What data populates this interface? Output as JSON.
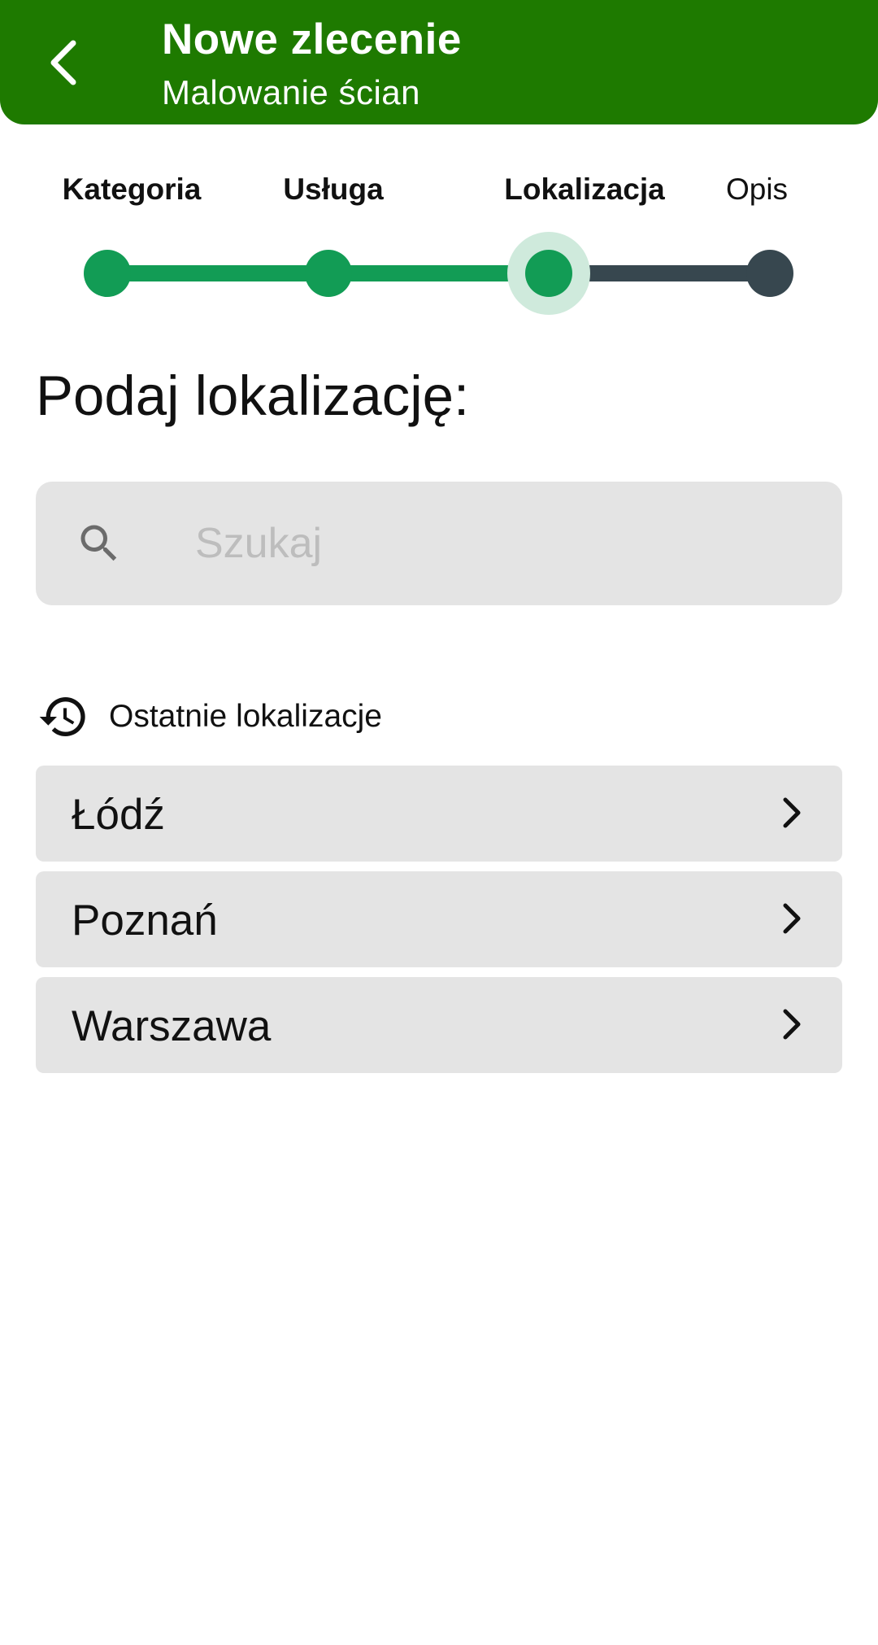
{
  "header": {
    "title": "Nowe zlecenie",
    "subtitle": "Malowanie ścian",
    "back_icon": "chevron-left-icon"
  },
  "stepper": {
    "steps": [
      {
        "label": "Kategoria",
        "state": "done"
      },
      {
        "label": "Usługa",
        "state": "done"
      },
      {
        "label": "Lokalizacja",
        "state": "current"
      },
      {
        "label": "Opis",
        "state": "pending"
      }
    ],
    "current_step": 3,
    "colors": {
      "done": "#129c55",
      "pending": "#37474f",
      "halo": "#cfeadc"
    }
  },
  "main": {
    "heading": "Podaj lokalizację:",
    "search": {
      "placeholder": "Szukaj",
      "value": "",
      "icon": "search-icon"
    },
    "recent": {
      "label": "Ostatnie lokalizacje",
      "icon": "history-icon",
      "items": [
        {
          "label": "Łódź"
        },
        {
          "label": "Poznań"
        },
        {
          "label": "Warszawa"
        }
      ]
    }
  },
  "colors": {
    "header_bg": "#1e7a00",
    "item_bg": "#e4e4e4",
    "placeholder": "#bdbdbd"
  }
}
